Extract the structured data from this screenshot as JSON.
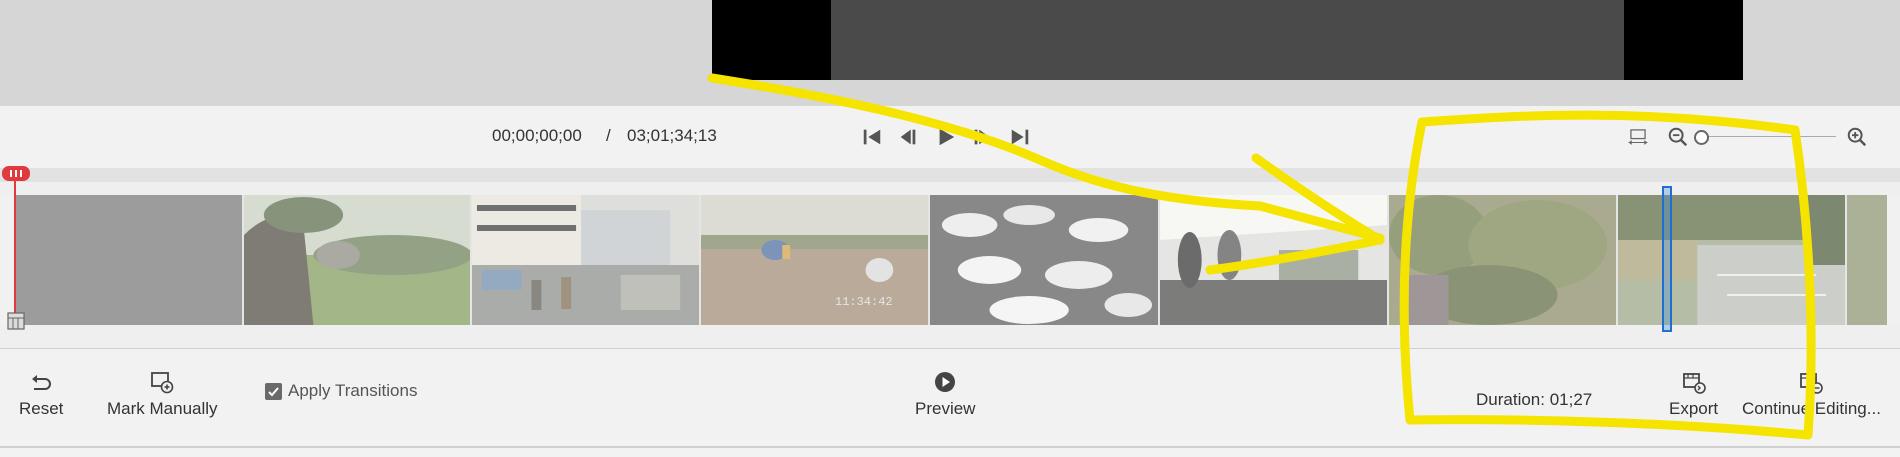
{
  "transport": {
    "current_time": "00;00;00;00",
    "separator": "/",
    "total_time": "03;01;34;13"
  },
  "bottom_bar": {
    "reset_label": "Reset",
    "mark_manually_label": "Mark Manually",
    "apply_transitions_label": "Apply Transitions",
    "apply_transitions_checked": true,
    "preview_label": "Preview",
    "duration_text": "Duration: 01;27",
    "export_label": "Export",
    "continue_editing_label": "Continue Editing..."
  },
  "icons": {
    "skip_start": "skip-to-start-icon",
    "step_back": "step-back-icon",
    "play": "play-icon",
    "step_forward": "step-forward-icon",
    "skip_end": "skip-to-end-icon",
    "fit": "fit-to-window-icon",
    "zoom_out": "zoom-out-icon",
    "zoom_in": "zoom-in-icon"
  },
  "filmstrip": {
    "thumbnails": [
      {
        "scene": "blank"
      },
      {
        "scene": "tree-field"
      },
      {
        "scene": "street"
      },
      {
        "scene": "field-workers"
      },
      {
        "scene": "swans"
      },
      {
        "scene": "market-stall"
      },
      {
        "scene": "bushes"
      },
      {
        "scene": "river"
      }
    ],
    "timestamps": [
      "11:34:42"
    ]
  },
  "colors": {
    "annotation": "#f5e400",
    "playhead": "#e0393e",
    "selection": "#1f6fd1"
  }
}
